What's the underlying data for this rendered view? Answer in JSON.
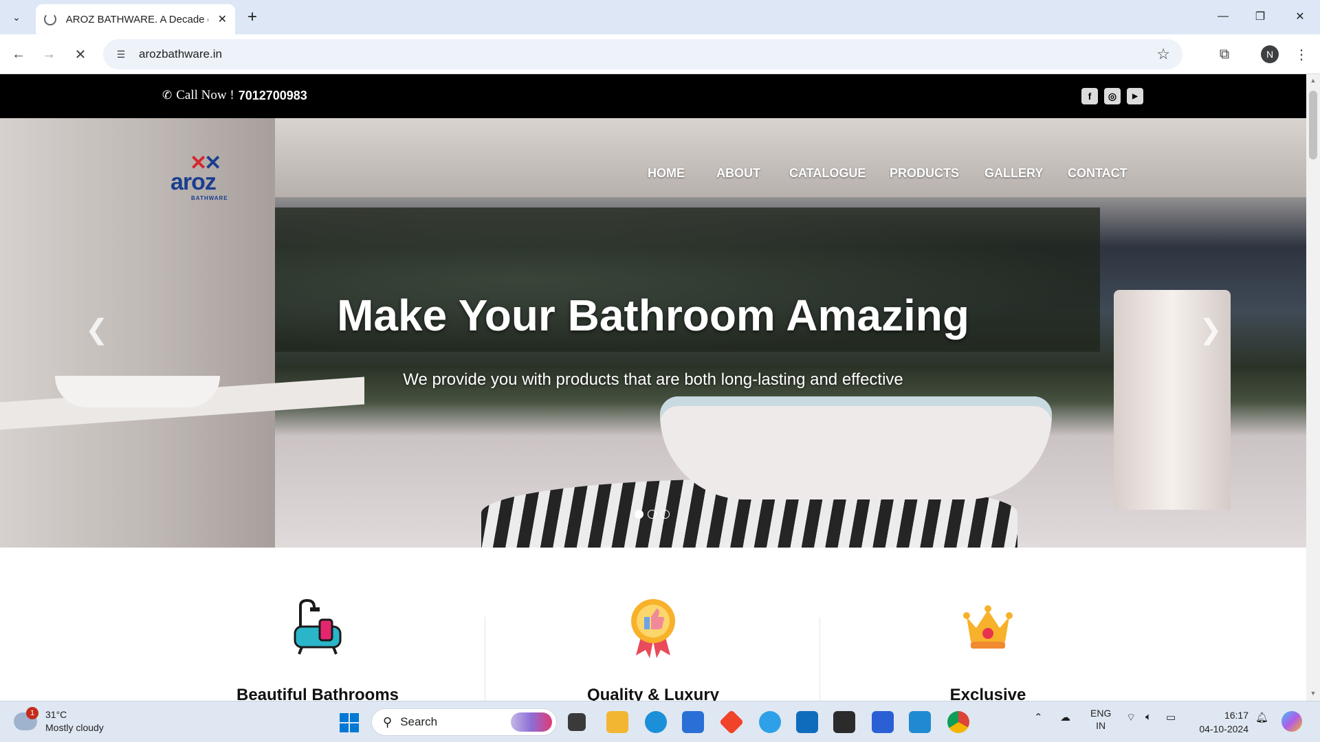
{
  "browser": {
    "tab_title": "AROZ BATHWARE. A Decade of",
    "url": "arozbathware.in",
    "profile_initial": "N"
  },
  "site": {
    "call_label": "Call Now !",
    "phone": "7012700983",
    "social": [
      "facebook-icon",
      "instagram-icon",
      "youtube-icon"
    ],
    "logo": {
      "wordmark": "aroz",
      "sub": "BATHWARE"
    },
    "menu": [
      "HOME",
      "ABOUT",
      "CATALOGUE",
      "PRODUCTS",
      "GALLERY",
      "CONTACT"
    ],
    "hero": {
      "title": "Make Your Bathroom Amazing",
      "subtitle": "We provide you with products that are both long-lasting and effective",
      "slides": 3,
      "active_slide": 1
    },
    "features": [
      {
        "label": "Beautiful Bathrooms",
        "icon": "bathtub-icon"
      },
      {
        "label": "Quality & Luxury",
        "icon": "award-badge-icon"
      },
      {
        "label": "Exclusive",
        "icon": "crown-icon"
      }
    ]
  },
  "taskbar": {
    "weather": {
      "temp": "31°C",
      "condition": "Mostly cloudy",
      "badge": "1"
    },
    "search_label": "Search",
    "lang_top": "ENG",
    "lang_bottom": "IN",
    "time": "16:17",
    "date": "04-10-2024"
  },
  "colors": {
    "brand_red": "#d6262f",
    "brand_blue": "#1b3e8f",
    "topbar": "#000000"
  }
}
